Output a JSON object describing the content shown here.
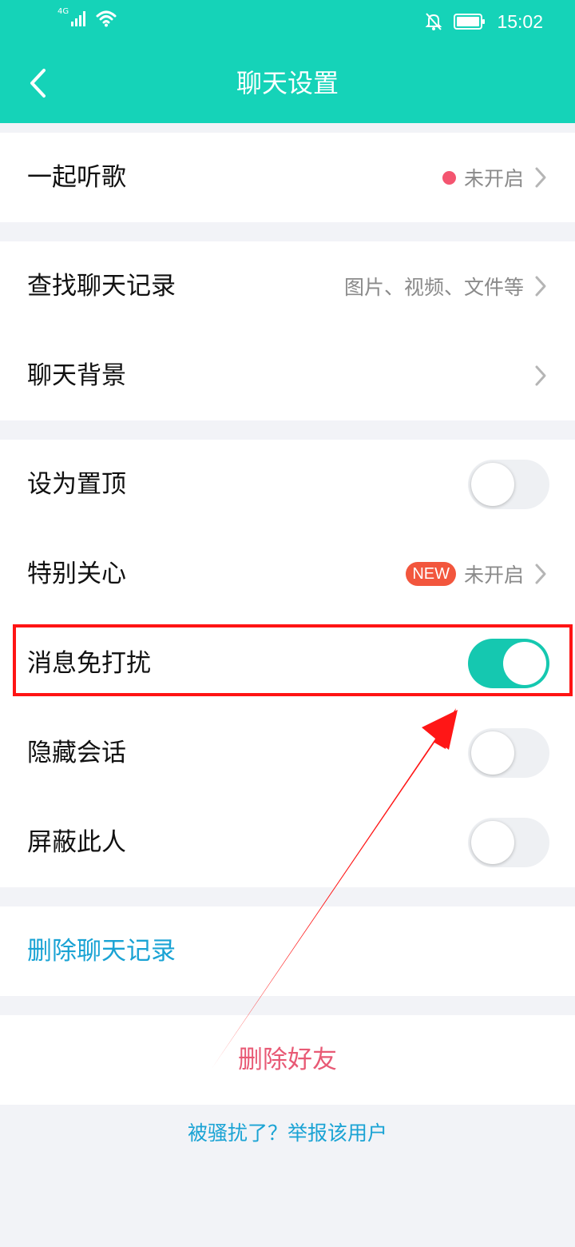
{
  "status_bar": {
    "network": "4G",
    "time": "15:02"
  },
  "header": {
    "title": "聊天设置",
    "background": "#15d3b8"
  },
  "rows": {
    "listen_together": {
      "label": "一起听歌",
      "value": "未开启"
    },
    "search_history": {
      "label": "查找聊天记录",
      "value": "图片、视频、文件等"
    },
    "chat_background": {
      "label": "聊天背景"
    },
    "pin_top": {
      "label": "设为置顶",
      "enabled": false
    },
    "special_care": {
      "label": "特别关心",
      "badge": "NEW",
      "value": "未开启"
    },
    "do_not_disturb": {
      "label": "消息免打扰",
      "enabled": true
    },
    "hide_chat": {
      "label": "隐藏会话",
      "enabled": false
    },
    "block_user": {
      "label": "屏蔽此人",
      "enabled": false
    }
  },
  "actions": {
    "delete_history": "删除聊天记录",
    "delete_friend": "删除好友",
    "report": "被骚扰了？举报该用户"
  },
  "colors": {
    "accent": "#15d3b8",
    "toggle_on": "#15c8b0",
    "link": "#1aa3d4",
    "danger": "#e85a75",
    "badge": "#f2563d",
    "annotation": "#ff1414"
  }
}
